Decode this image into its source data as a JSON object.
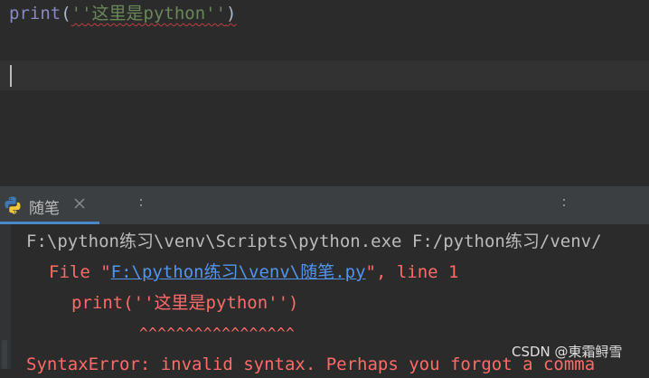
{
  "editor": {
    "code": {
      "func": "print",
      "open": "(",
      "string": "''这里是python''",
      "close": ")"
    }
  },
  "run_panel": {
    "tab": {
      "label": "随笔",
      "icon": "python-icon",
      "close_icon": "close-icon"
    },
    "output": {
      "line1": "F:\\python练习\\venv\\Scripts\\python.exe F:/python练习/venv/",
      "line2_prefix": "File \"",
      "line2_link": "F:\\python练习\\venv\\随笔.py",
      "line2_suffix": "\", line 1",
      "line3": "print(''这里是python'')",
      "line4": "^^^^^^^^^^^^^^^^^",
      "line5": "SyntaxError: invalid syntax. Perhaps you forgot a comma"
    }
  },
  "watermark": "CSDN @東霜鲟雪",
  "colors": {
    "background": "#2b2b2b",
    "error_text": "#ff6b68",
    "link": "#5394ec",
    "tab_underline": "#4a88c7"
  }
}
